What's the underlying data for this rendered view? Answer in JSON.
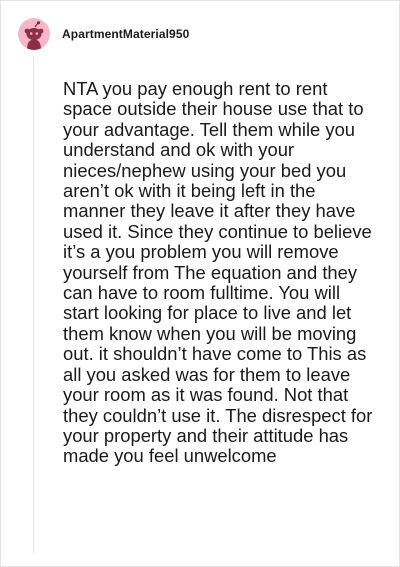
{
  "comment": {
    "username": "ApartmentMaterial950",
    "avatar_icon": "reddit-snoo-avatar-icon",
    "avatar_bg": "#f4b6c8",
    "body": "NTA you pay enough rent to rent space outside their house use that to your advantage. Tell them while you understand and ok with your nieces/nephew using your bed you aren’t ok with it being left in the manner they leave it after they have used it. Since they continue to believe it’s a you problem you will remove yourself from The equation and they can have to room fulltime. You will start looking for place to live and let them know when you will be moving out. it shouldn’t have come to This as all you asked was for them to leave your room as it was found. Not that they couldn’t use it. The disrespect for your property and their attitude has made you feel unwelcome"
  }
}
